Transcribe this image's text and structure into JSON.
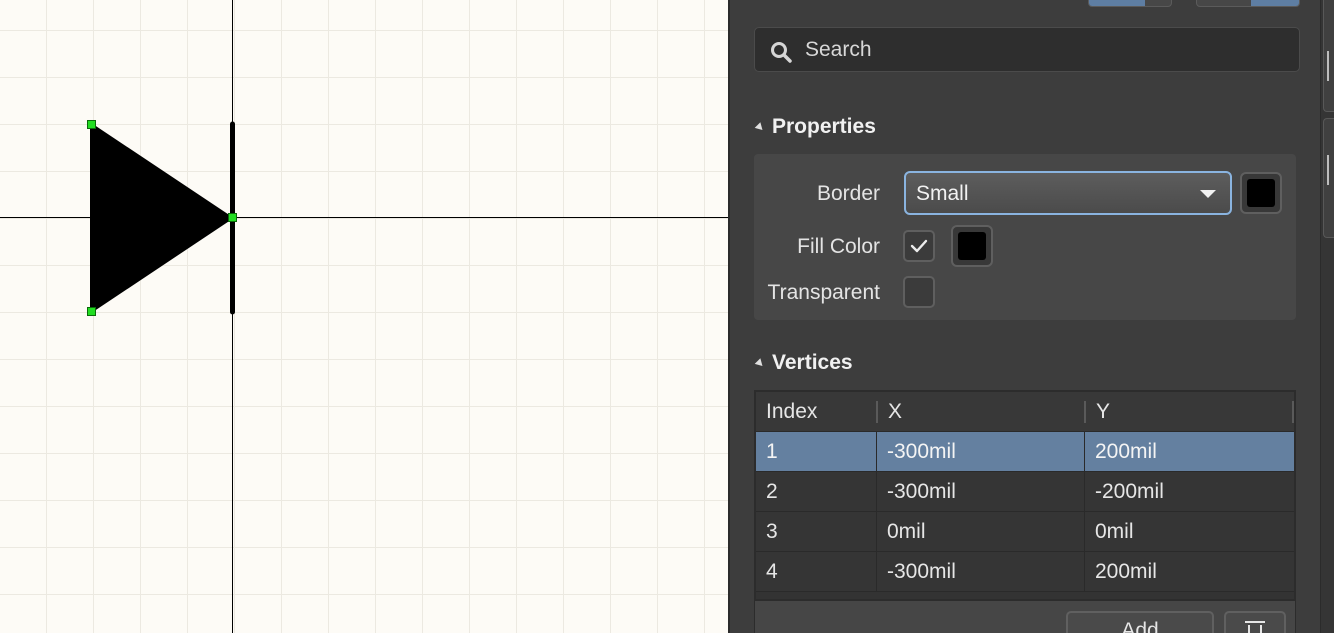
{
  "canvas": {
    "grid_color": "#ece9e1",
    "background_color": "#fdfbf6",
    "shape": {
      "fill_color": "#000000",
      "handle_color": "#22dd22"
    }
  },
  "search": {
    "placeholder": "Search",
    "icon": "search-icon"
  },
  "properties": {
    "title": "Properties",
    "border_label": "Border",
    "border_value": "Small",
    "border_color": "#000000",
    "fill_color_label": "Fill Color",
    "fill_color_checked": true,
    "fill_color": "#000000",
    "transparent_label": "Transparent",
    "transparent_checked": false
  },
  "vertices": {
    "title": "Vertices",
    "columns": [
      "Index",
      "X",
      "Y"
    ],
    "rows": [
      {
        "index": "1",
        "x": "-300mil",
        "y": "200mil",
        "selected": true
      },
      {
        "index": "2",
        "x": "-300mil",
        "y": "-200mil",
        "selected": false
      },
      {
        "index": "3",
        "x": "0mil",
        "y": "0mil",
        "selected": false
      },
      {
        "index": "4",
        "x": "-300mil",
        "y": "200mil",
        "selected": false
      }
    ],
    "add_label": "Add",
    "delete_icon": "trash-icon"
  },
  "colors": {
    "accent": "#6480a0",
    "focus_border": "#8ab4e0",
    "panel_bg": "#3d3d3d"
  }
}
